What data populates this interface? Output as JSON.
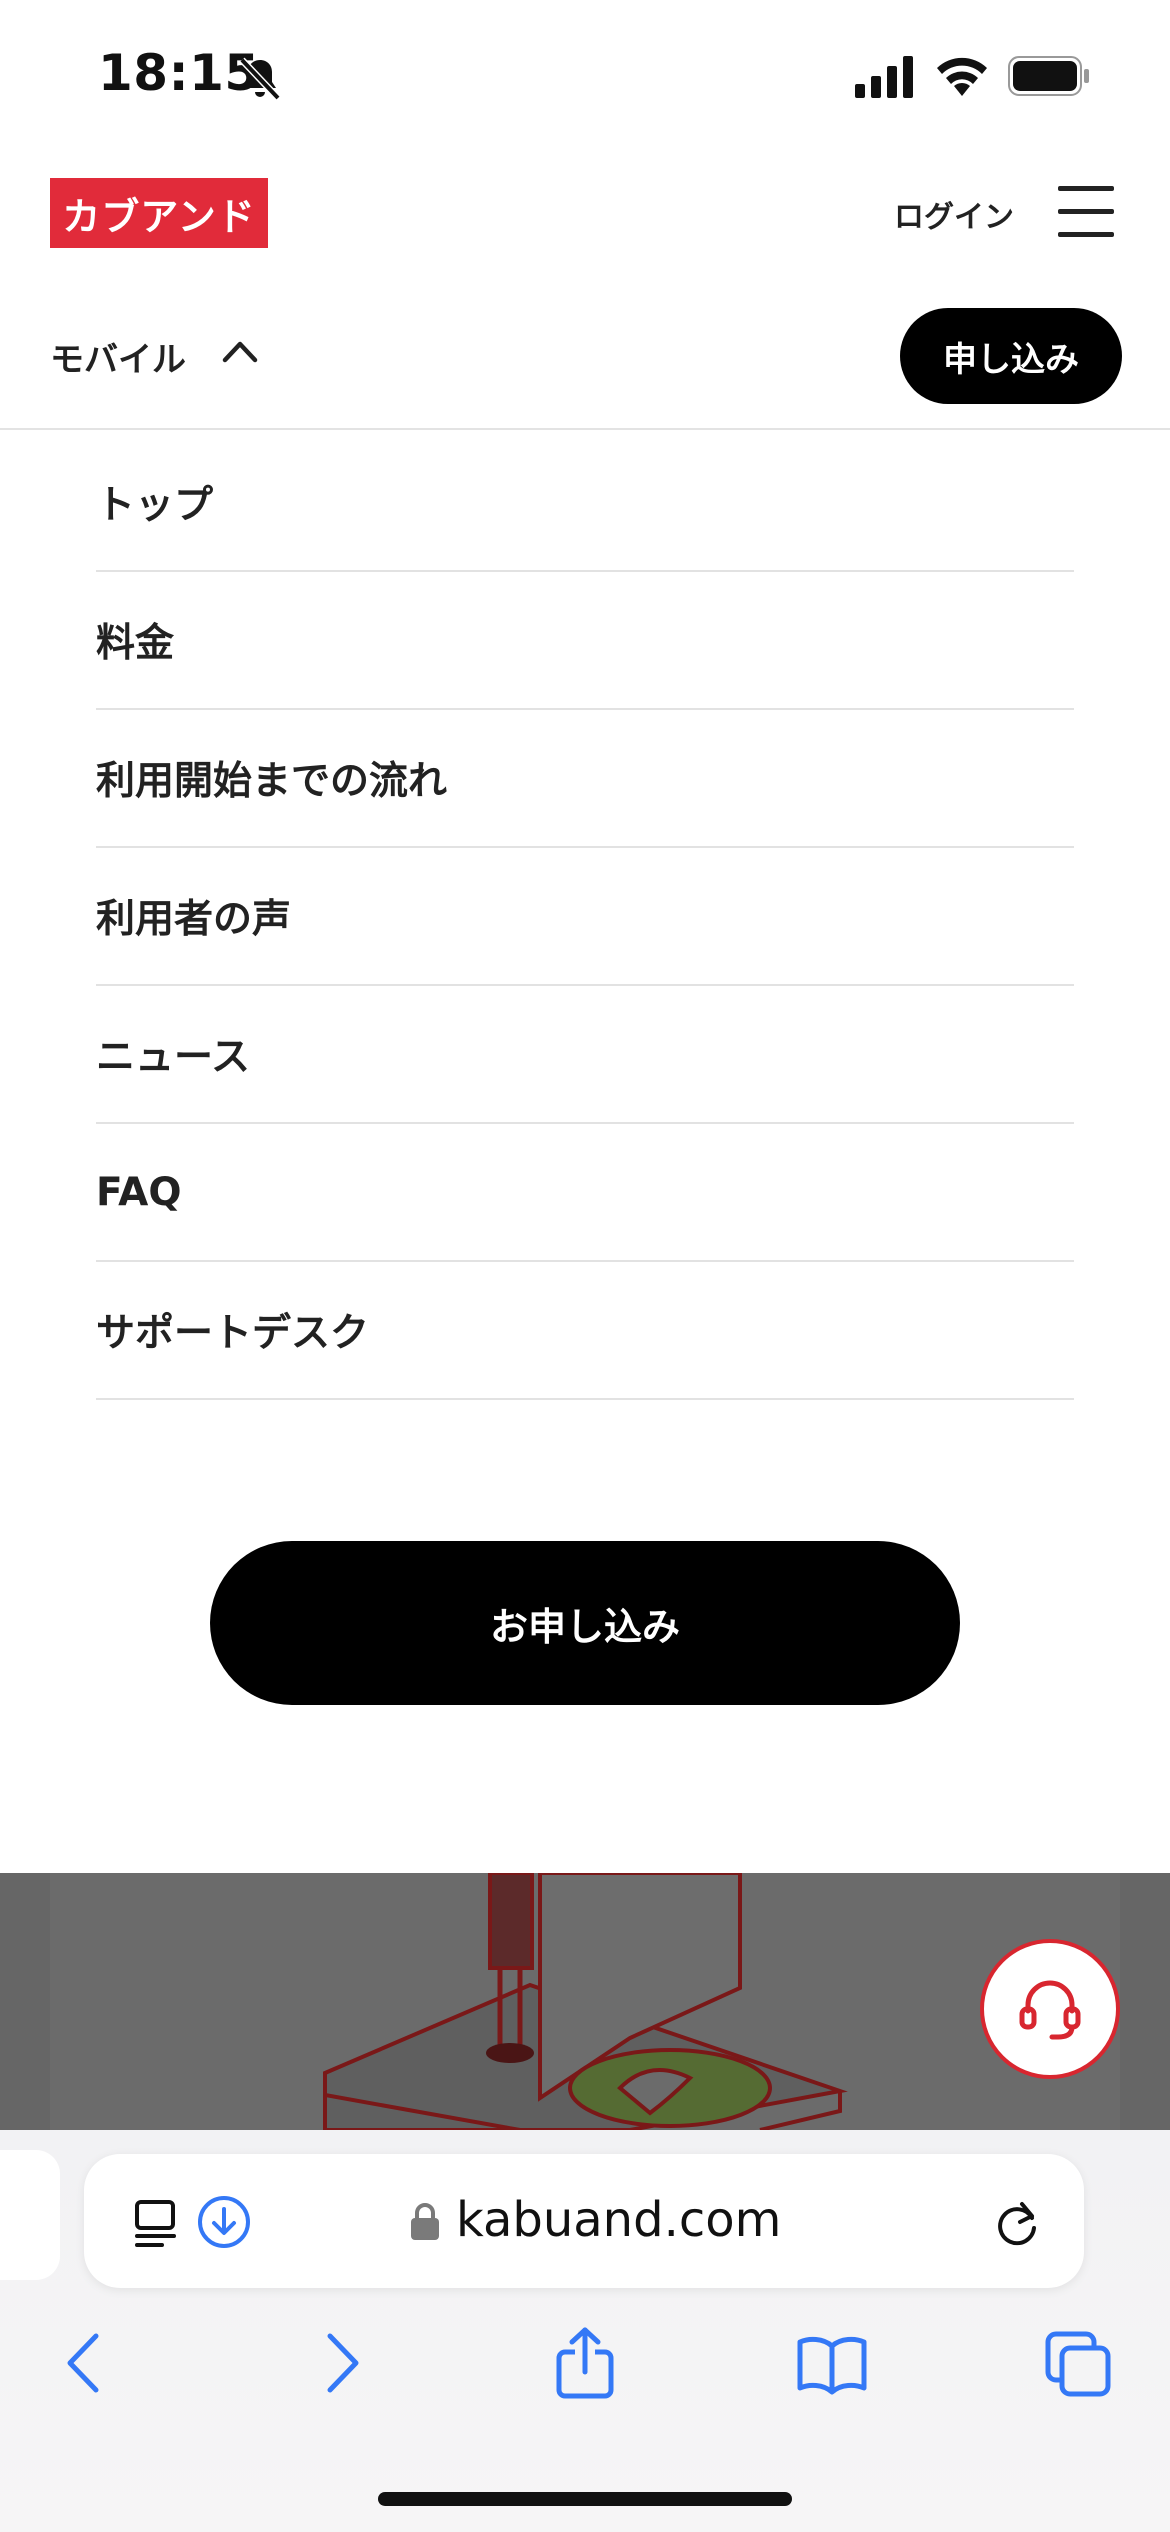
{
  "status_bar": {
    "time": "18:15",
    "icons": [
      "bell-slash-icon",
      "signal-icon",
      "wifi-icon",
      "battery-icon"
    ]
  },
  "header": {
    "logo_text": "カブアンド",
    "login_label": "ログイン",
    "section_label": "モバイル",
    "apply_label": "申し込み",
    "brand_color": "#e12b3a"
  },
  "menu": {
    "items": [
      {
        "label": "トップ"
      },
      {
        "label": "料金"
      },
      {
        "label": "利用開始までの流れ"
      },
      {
        "label": "利用者の声"
      },
      {
        "label": "ニュース"
      },
      {
        "label": "FAQ"
      },
      {
        "label": "サポートデスク"
      }
    ],
    "apply_button_label": "お申し込み"
  },
  "browser": {
    "url": "kabuand.com",
    "toolbar": [
      "back-icon",
      "forward-icon",
      "share-icon",
      "bookmarks-icon",
      "tabs-icon"
    ],
    "accent_color": "#3478f6"
  }
}
